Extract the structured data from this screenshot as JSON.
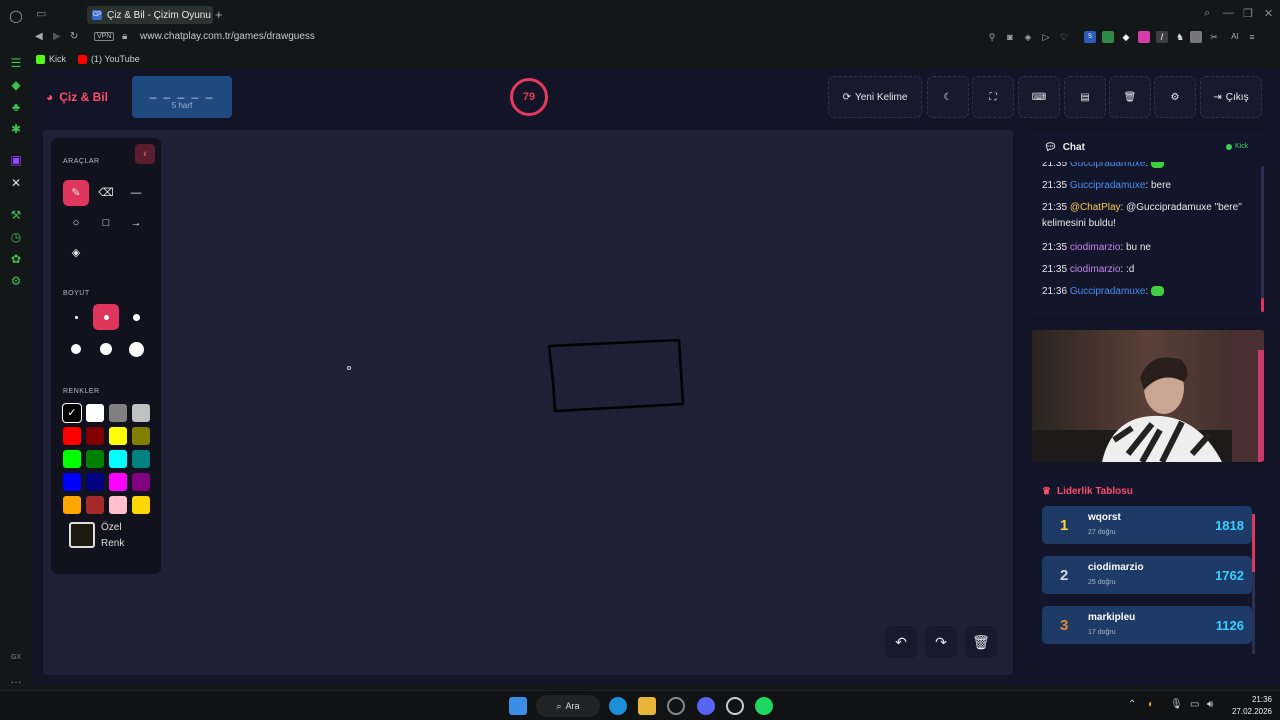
{
  "browser": {
    "tab_title": "Çiz & Bil - Çizim Oyunu",
    "tab_favicon": "CP",
    "vpn": "VPN",
    "url": "www.chatplay.com.tr/games/drawguess",
    "ext_ai": "AI",
    "bookmarks": [
      "Kick",
      "(1) YouTube"
    ]
  },
  "header": {
    "logo": "Çiz & Bil",
    "word_dashes": "_ _ _ _ _",
    "word_hint": "5 harf",
    "timer": "79",
    "new_word_label": "Yeni Kelime",
    "exit_label": "Çıkış"
  },
  "tools": {
    "title": "ARAÇLAR",
    "size_title": "BOYUT",
    "colors_title": "RENKLER",
    "custom_color_label": "Özel Renk",
    "palette": [
      "#000000",
      "#ffffff",
      "#808080",
      "#c0c0c0",
      "#ff0000",
      "#800000",
      "#ffff00",
      "#808000",
      "#00ff00",
      "#008000",
      "#00ffff",
      "#008080",
      "#0000ff",
      "#000080",
      "#ff00ff",
      "#800080",
      "#ffa500",
      "#a52a2a",
      "#ffc0cb",
      "#ffd700"
    ],
    "selected_color": "#000000",
    "custom_color": "#1d1b0f",
    "accent": "#e0355d"
  },
  "chat": {
    "title": "Chat",
    "platform": "Kick",
    "messages": [
      {
        "time": "21:35",
        "user": "Guccipradamuxe",
        "text": "",
        "emote": true
      },
      {
        "time": "21:35",
        "user": "Guccipradamuxe",
        "text": "bere"
      },
      {
        "time": "21:35",
        "user": "@ChatPlay",
        "text": "@Guccipradamuxe \"bere\" kelimesini buldu!"
      },
      {
        "time": "21:35",
        "user": "ciodimarzio",
        "text": "bu ne"
      },
      {
        "time": "21:35",
        "user": "ciodimarzio",
        "text": ":d"
      },
      {
        "time": "21:36",
        "user": "Guccipradamuxe",
        "text": "",
        "emote": true
      }
    ]
  },
  "leaderboard": {
    "title": "Liderlik Tablosu",
    "rows": [
      {
        "rank": "1",
        "name": "wqorst",
        "sub": "27 doğru",
        "score": "1818",
        "rank_color": "#ffd23a"
      },
      {
        "rank": "2",
        "name": "ciodimarzio",
        "sub": "25 doğru",
        "score": "1762",
        "rank_color": "#d8dde8"
      },
      {
        "rank": "3",
        "name": "markipleu",
        "sub": "17 doğru",
        "score": "1126",
        "rank_color": "#e0893a"
      }
    ]
  },
  "taskbar": {
    "search": "Ara",
    "time": "21:36",
    "date": "27.02.2026"
  }
}
